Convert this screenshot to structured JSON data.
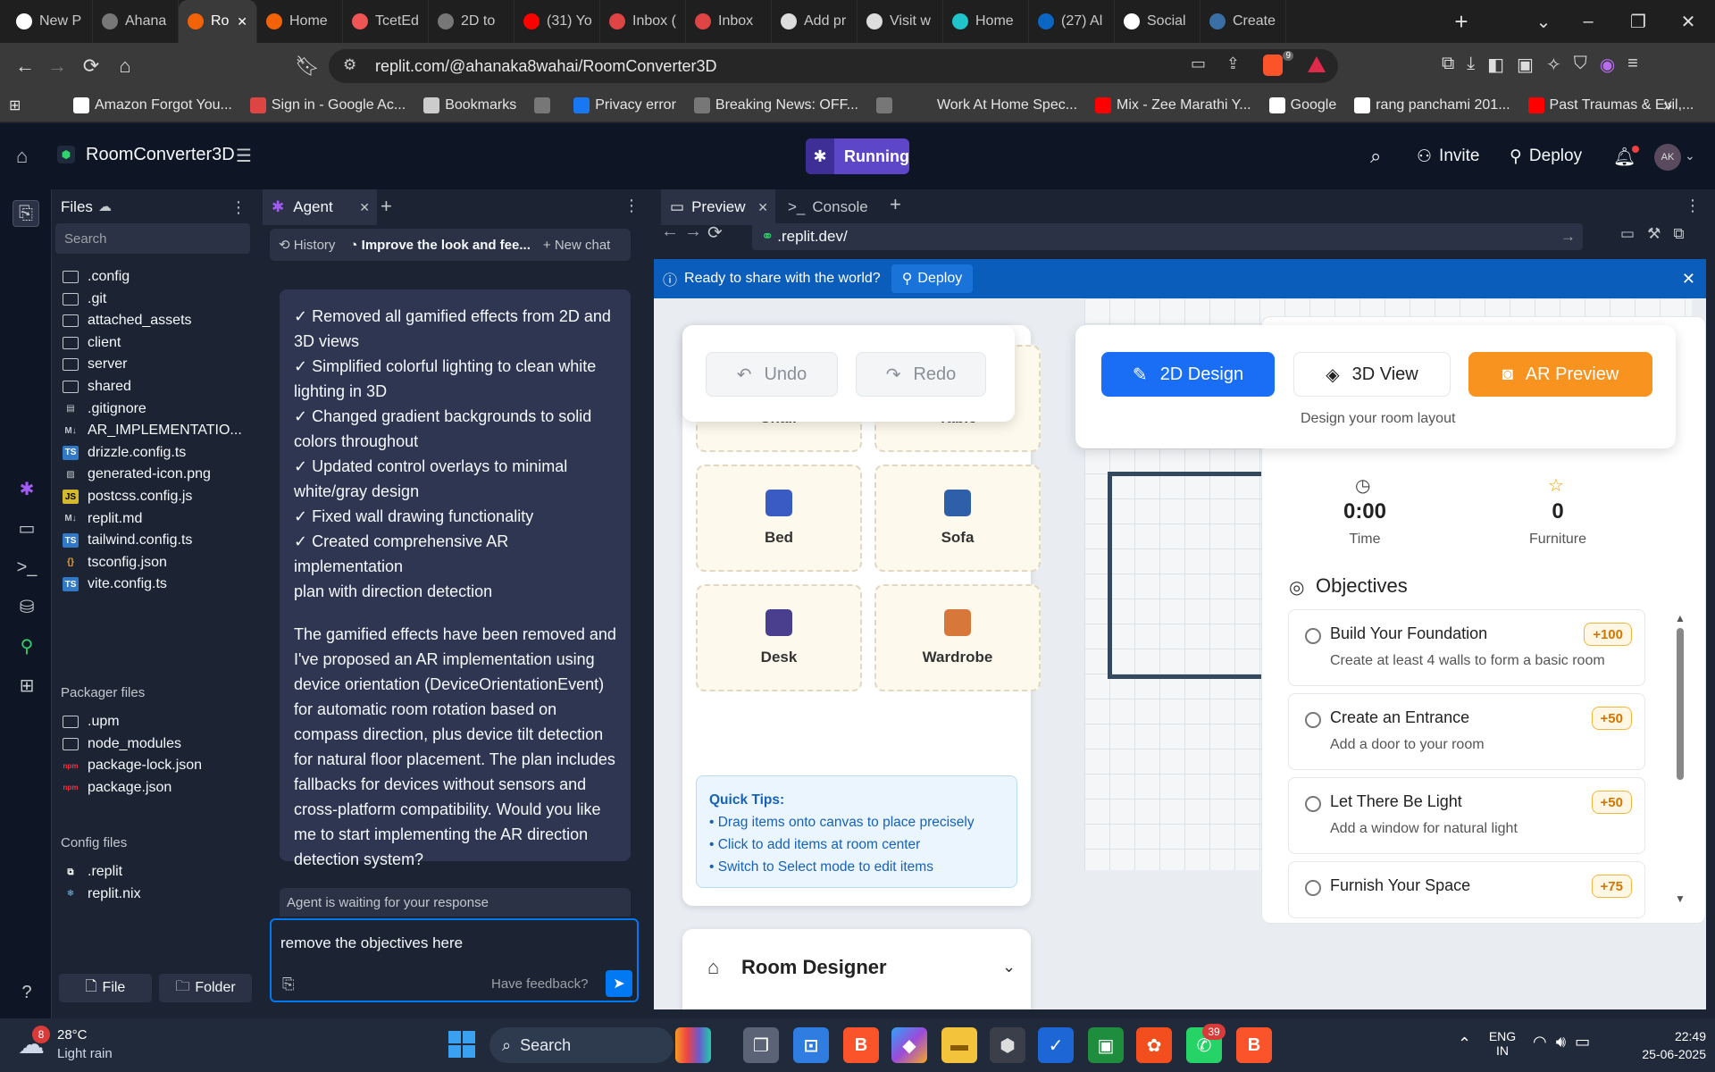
{
  "browser": {
    "tabs": [
      {
        "label": "New P",
        "icon": "notion-icon",
        "active": false
      },
      {
        "label": "Ahana",
        "icon": "globe-icon",
        "active": false
      },
      {
        "label": "Ro",
        "icon": "replit-icon",
        "active": true
      },
      {
        "label": "Home",
        "icon": "replit-icon",
        "active": false
      },
      {
        "label": "TcetEd",
        "icon": "tcet-icon",
        "active": false
      },
      {
        "label": "2D to",
        "icon": "globe-icon",
        "active": false
      },
      {
        "label": "(31) Yo",
        "icon": "youtube-icon",
        "active": false
      },
      {
        "label": "Inbox (",
        "icon": "gmail-icon",
        "active": false
      },
      {
        "label": "Inbox",
        "icon": "gmail-icon",
        "active": false
      },
      {
        "label": "Add pr",
        "icon": "openai-icon",
        "active": false
      },
      {
        "label": "Visit w",
        "icon": "openai-icon",
        "active": false
      },
      {
        "label": "Home",
        "icon": "canva-icon",
        "active": false
      },
      {
        "label": "(27) Al",
        "icon": "linkedin-icon",
        "active": false
      },
      {
        "label": "Social",
        "icon": "medium-icon",
        "active": false
      },
      {
        "label": "Create",
        "icon": "wordpress-icon",
        "active": false
      }
    ],
    "url": "replit.com/@ahanaka8wahai/RoomConverter3D",
    "brave_badge": "9",
    "bookmarks": [
      {
        "label": "Amazon Forgot You...",
        "icon": "amazon-icon"
      },
      {
        "label": "Sign in - Google Ac...",
        "icon": "gmail-icon"
      },
      {
        "label": "Bookmarks",
        "icon": "bookmarks-icon"
      },
      {
        "label": "",
        "icon": "globe-icon"
      },
      {
        "label": "Privacy error",
        "icon": "facebook-icon"
      },
      {
        "label": "Breaking News: OFF...",
        "icon": "globe-icon"
      },
      {
        "label": "",
        "icon": "globe-icon"
      },
      {
        "label": "Work At Home Spec...",
        "icon": "blank-icon"
      },
      {
        "label": "Mix - Zee Marathi Y...",
        "icon": "youtube-icon"
      },
      {
        "label": "Google",
        "icon": "google-icon"
      },
      {
        "label": "rang panchami 201...",
        "icon": "google-icon"
      },
      {
        "label": "Past Traumas & Evil,...",
        "icon": "youtube-icon"
      }
    ]
  },
  "replit": {
    "project_name": "RoomConverter3D",
    "status": "Running",
    "invite_label": "Invite",
    "deploy_label": "Deploy",
    "avatar_initials": "AK"
  },
  "files": {
    "title": "Files",
    "search_placeholder": "Search",
    "items": [
      {
        "name": ".config",
        "kind": "folder"
      },
      {
        "name": ".git",
        "kind": "folder"
      },
      {
        "name": "attached_assets",
        "kind": "folder"
      },
      {
        "name": "client",
        "kind": "folder"
      },
      {
        "name": "server",
        "kind": "folder"
      },
      {
        "name": "shared",
        "kind": "folder"
      },
      {
        "name": ".gitignore",
        "kind": "doc"
      },
      {
        "name": "AR_IMPLEMENTATIO...",
        "kind": "md"
      },
      {
        "name": "drizzle.config.ts",
        "kind": "ts"
      },
      {
        "name": "generated-icon.png",
        "kind": "img"
      },
      {
        "name": "postcss.config.js",
        "kind": "js"
      },
      {
        "name": "replit.md",
        "kind": "md"
      },
      {
        "name": "tailwind.config.ts",
        "kind": "ts"
      },
      {
        "name": "tsconfig.json",
        "kind": "json"
      },
      {
        "name": "vite.config.ts",
        "kind": "ts"
      }
    ],
    "packager_title": "Packager files",
    "packager_items": [
      {
        "name": ".upm",
        "kind": "folder"
      },
      {
        "name": "node_modules",
        "kind": "folder"
      },
      {
        "name": "package-lock.json",
        "kind": "npm"
      },
      {
        "name": "package.json",
        "kind": "npm"
      }
    ],
    "config_title": "Config files",
    "config_items": [
      {
        "name": ".replit",
        "kind": "replit"
      },
      {
        "name": "replit.nix",
        "kind": "nix"
      }
    ],
    "new_file_label": "File",
    "new_folder_label": "Folder"
  },
  "agent": {
    "tab_label": "Agent",
    "history_label": "History",
    "chat_title": "Improve the look and fee...",
    "new_chat_label": "New chat",
    "message_lines": [
      "✓ Removed all gamified effects from 2D and",
      "3D views",
      "✓ Simplified colorful lighting to clean white",
      "lighting in 3D",
      "✓ Changed gradient backgrounds to solid",
      "colors throughout",
      "✓ Updated control overlays to minimal",
      "white/gray design",
      "✓ Fixed wall drawing functionality",
      "✓ Created comprehensive AR implementation",
      "plan with direction detection"
    ],
    "message_paragraph_lines": [
      "The gamified effects have been removed and",
      "I've proposed an AR implementation using",
      "device orientation (DeviceOrientationEvent)",
      "for automatic room rotation based on",
      "compass direction, plus device tilt detection",
      "for natural floor placement. The plan includes",
      "fallbacks for devices without sensors and",
      "cross-platform compatibility. Would you like",
      "me to start implementing the AR direction",
      "detection system?"
    ],
    "waiting_text": "Agent is waiting for your response",
    "input_value": "remove the objectives here",
    "feedback_label": "Have feedback?"
  },
  "preview": {
    "tab_label": "Preview",
    "console_label": "Console",
    "url": ".replit.dev/",
    "banner_text": "Ready to share with the world?",
    "banner_deploy": "Deploy"
  },
  "app": {
    "undo_label": "Undo",
    "redo_label": "Redo",
    "mode_2d": "2D Design",
    "mode_3d": "3D View",
    "mode_ar": "AR Preview",
    "mode_caption": "Design your room layout",
    "furniture": [
      {
        "label": "Chair",
        "icon": "chair-icon",
        "color": "#8b3a3a"
      },
      {
        "label": "Table",
        "icon": "table-icon",
        "color": "#c9b48a"
      },
      {
        "label": "Bed",
        "icon": "bed-icon",
        "color": "#3b5bc4"
      },
      {
        "label": "Sofa",
        "icon": "sofa-icon",
        "color": "#2f5fa8"
      },
      {
        "label": "Desk",
        "icon": "desk-icon",
        "color": "#4a3f8f"
      },
      {
        "label": "Wardrobe",
        "icon": "wardrobe-icon",
        "color": "#d8773a"
      }
    ],
    "tips_title": "Quick Tips:",
    "tips": [
      "• Drag items onto canvas to place precisely",
      "• Click to add items at room center",
      "• Switch to Select mode to edit items"
    ],
    "room_designer_label": "Room Designer",
    "time_value": "0:00",
    "time_label": "Time",
    "furniture_count": "0",
    "furniture_count_label": "Furniture",
    "objectives_title": "Objectives",
    "objectives": [
      {
        "title": "Build Your Foundation",
        "desc": "Create at least 4 walls to form a basic room",
        "points": "+100"
      },
      {
        "title": "Create an Entrance",
        "desc": "Add a door to your room",
        "points": "+50"
      },
      {
        "title": "Let There Be Light",
        "desc": "Add a window for natural light",
        "points": "+50"
      },
      {
        "title": "Furnish Your Space",
        "desc": "",
        "points": "+75"
      }
    ]
  },
  "taskbar": {
    "weather_temp": "28°C",
    "weather_desc": "Light rain",
    "weather_badge": "8",
    "search_label": "Search",
    "whatsapp_badge": "39",
    "lang_line1": "ENG",
    "lang_line2": "IN",
    "time": "22:49",
    "date": "25-06-2025"
  },
  "colors": {
    "accent_blue": "#0079f2",
    "running_purple": "#5d46c8",
    "mode_2d_blue": "#1a6ef5",
    "ar_orange": "#f7931e",
    "points_orange": "#d47500"
  }
}
